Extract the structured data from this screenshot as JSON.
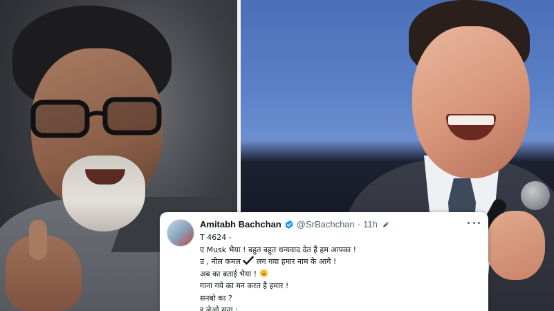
{
  "tweet": {
    "author_name": "Amitabh Bachchan",
    "author_handle": "@SrBachchan",
    "separator": "·",
    "time": "11h",
    "lines": [
      "T 4624 -",
      "ए Musk भैया ! बहुत बहुत धन्यवाद देत हैं हम आपका !",
      "उ , नील कमल",
      "लग गवा हमार नाम के आगे !",
      "अब का बताई भैया !",
      "गाना गये का मन करत है हमार !",
      "सनबो का ?",
      "इ लेओ सुना :"
    ],
    "verified_color": "#1d9bf0",
    "icons": [
      "verified-badge-icon",
      "edit-icon",
      "more-icon",
      "check-mark-icon",
      "grin-emoji-icon"
    ]
  }
}
